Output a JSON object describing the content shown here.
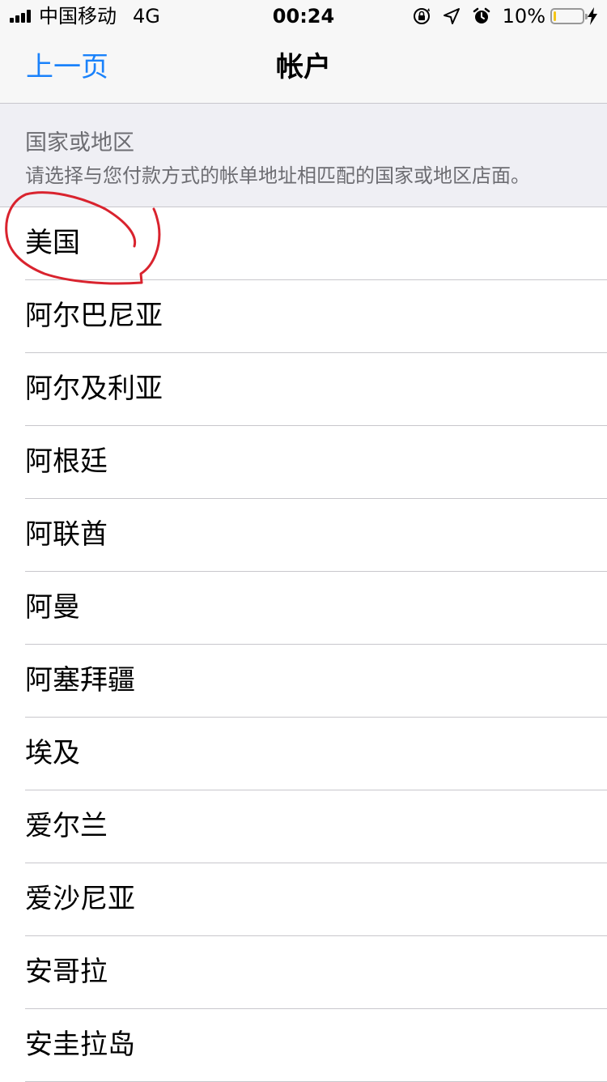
{
  "status_bar": {
    "carrier": "中国移动",
    "network": "4G",
    "time": "00:24",
    "battery_percent": "10%",
    "battery_level": 0.1,
    "battery_color": "#f5c518",
    "icons": [
      "signal-icon",
      "orientation-lock-icon",
      "location-arrow-icon",
      "alarm-icon",
      "battery-icon",
      "charging-bolt-icon"
    ]
  },
  "nav": {
    "back_label": "上一页",
    "title": "帐户",
    "accent_color": "#1a82fb"
  },
  "section": {
    "title": "国家或地区",
    "subtitle": "请选择与您付款方式的帐单地址相匹配的国家或地区店面。"
  },
  "countries": [
    {
      "name": "美国"
    },
    {
      "name": "阿尔巴尼亚"
    },
    {
      "name": "阿尔及利亚"
    },
    {
      "name": "阿根廷"
    },
    {
      "name": "阿联酋"
    },
    {
      "name": "阿曼"
    },
    {
      "name": "阿塞拜疆"
    },
    {
      "name": "埃及"
    },
    {
      "name": "爱尔兰"
    },
    {
      "name": "爱沙尼亚"
    },
    {
      "name": "安哥拉"
    },
    {
      "name": "安圭拉岛"
    }
  ],
  "annotation": {
    "color": "#d9232e",
    "encircled_item": "美国"
  }
}
